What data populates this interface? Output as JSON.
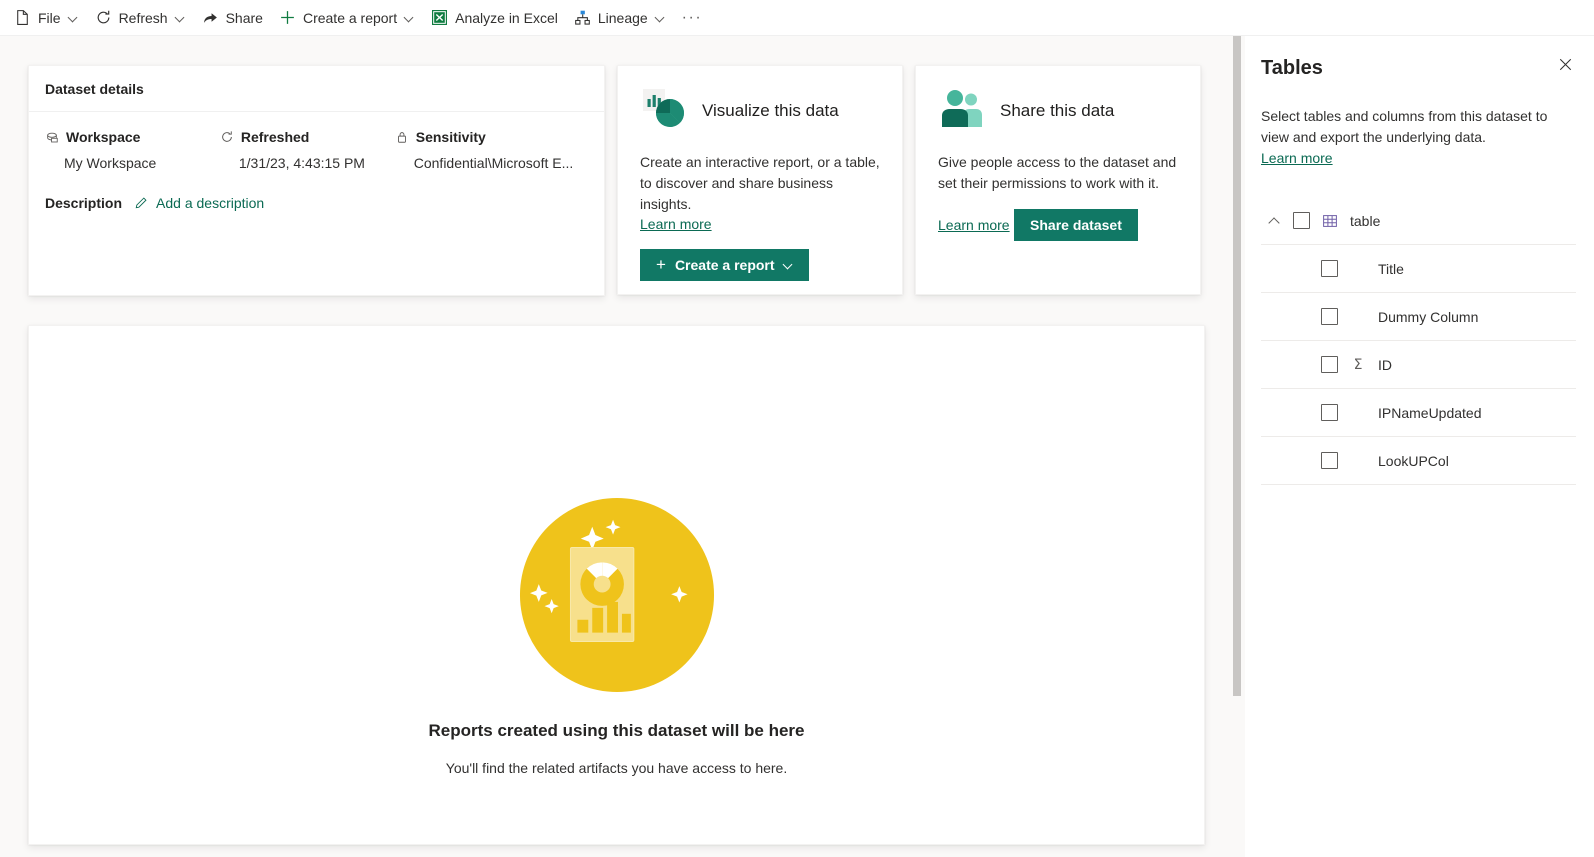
{
  "commandbar": {
    "items": [
      {
        "label": "File",
        "icon": "file-icon",
        "caret": true
      },
      {
        "label": "Refresh",
        "icon": "refresh-icon",
        "caret": true
      },
      {
        "label": "Share",
        "icon": "share-icon",
        "caret": false
      },
      {
        "label": "Create a report",
        "icon": "plus-icon",
        "caret": true
      },
      {
        "label": "Analyze in Excel",
        "icon": "excel-icon",
        "caret": false
      },
      {
        "label": "Lineage",
        "icon": "lineage-icon",
        "caret": true
      }
    ],
    "overflow_label": "···",
    "overflow_name": "more-commands-icon"
  },
  "details_card": {
    "header": "Dataset details",
    "fields": [
      {
        "label": "Workspace",
        "value": "My Workspace",
        "icon": "workspace-icon"
      },
      {
        "label": "Refreshed",
        "value": "1/31/23, 4:43:15 PM",
        "icon": "refresh-icon"
      },
      {
        "label": "Sensitivity",
        "value": "Confidential\\Microsoft E...",
        "icon": "lock-icon"
      }
    ],
    "description_label": "Description",
    "add_description": "Add a description",
    "add_description_icon": "pencil-icon"
  },
  "visualize_card": {
    "icon": "chart-pie-icon",
    "title": "Visualize this data",
    "description": "Create an interactive report, or a table, to discover and share business insights.",
    "learn_more": "Learn more",
    "button_label": "Create a report",
    "button_icon": "plus-icon"
  },
  "share_card": {
    "icon": "people-icon",
    "title": "Share this data",
    "description": "Give people access to the dataset and set their permissions to work with it.",
    "learn_more": "Learn more",
    "button_label": "Share dataset"
  },
  "empty_state": {
    "illustration": "report-illustration",
    "title": "Reports created using this dataset will be here",
    "subtitle": "You'll find the related artifacts you have access to here."
  },
  "tables_panel": {
    "title": "Tables",
    "close_icon": "close-icon",
    "description": "Select tables and columns from this dataset to view and export the underlying data.",
    "learn_more": "Learn more",
    "table": {
      "name": "table",
      "icon": "table-grid-icon",
      "expanded": true,
      "checked": false,
      "columns": [
        {
          "name": "Title",
          "checked": false,
          "measure": false
        },
        {
          "name": "Dummy Column",
          "checked": false,
          "measure": false
        },
        {
          "name": "ID",
          "checked": false,
          "measure": true,
          "measure_icon": "sigma-icon"
        },
        {
          "name": "IPNameUpdated",
          "checked": false,
          "measure": false
        },
        {
          "name": "LookUPCol",
          "checked": false,
          "measure": false
        }
      ]
    }
  },
  "colors": {
    "accent_green": "#117865",
    "link_green": "#0b6a53",
    "illustration_yellow": "#EFC31B",
    "excel_green": "#107C41",
    "page_background": "#faf9f8"
  }
}
